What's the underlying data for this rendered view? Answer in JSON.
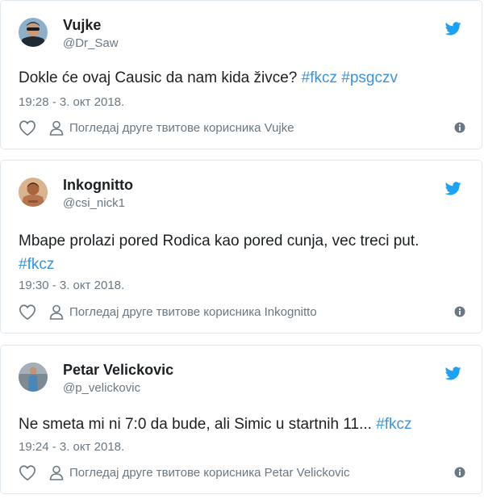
{
  "tweets": [
    {
      "name": "Vujke",
      "handle": "@Dr_Saw",
      "text": "Dokle će ovaj Causic da nam kida živce?",
      "hashtags": [
        "#fkcz",
        "#psgczv"
      ],
      "time": "19:28 - 3. окт 2018.",
      "profile_link": "Погледај друге твитове корисника Vujke",
      "avatar_icon": "avatar-sunglasses-man",
      "icons": [
        "heart-icon",
        "person-icon",
        "info-icon",
        "twitter-bird-icon"
      ]
    },
    {
      "name": "Inkognitto",
      "handle": "@csi_nick1",
      "text": "Mbape prolazi pored Rodica kao pored cunja, vec treci put.",
      "hashtags": [
        "#fkcz"
      ],
      "time": "19:30 - 3. окт 2018.",
      "profile_link": "Погледај друге твитове корисника Inkognitto",
      "avatar_icon": "avatar-shirtless-man",
      "icons": [
        "heart-icon",
        "person-icon",
        "info-icon",
        "twitter-bird-icon"
      ]
    },
    {
      "name": "Petar Velickovic",
      "handle": "@p_velickovic",
      "text": "Ne smeta mi ni 7:0 da bude, ali Simic u startnih 11...",
      "hashtags": [
        "#fkcz"
      ],
      "time": "19:24 - 3. окт 2018.",
      "profile_link": "Погледај друге твитове корисника Petar Velickovic",
      "avatar_icon": "avatar-standing-man",
      "icons": [
        "heart-icon",
        "person-icon",
        "info-icon",
        "twitter-bird-icon"
      ]
    }
  ],
  "colors": {
    "text": "#1c2022",
    "muted": "#697882",
    "link": "#3b94d9",
    "bird": "#1da1f2",
    "border": "#e1e8ed"
  }
}
